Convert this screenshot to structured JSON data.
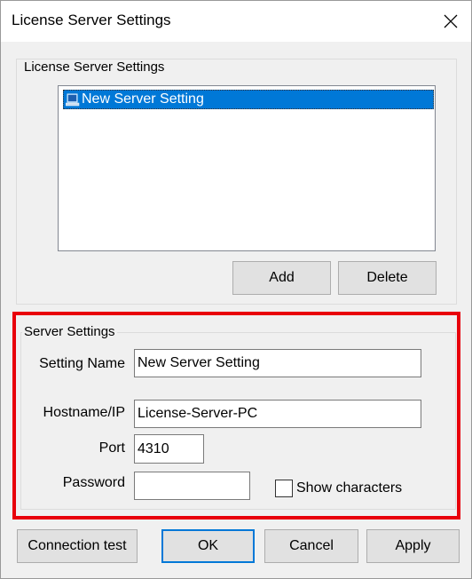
{
  "window": {
    "title": "License Server Settings",
    "close_icon": "close-icon"
  },
  "license_group": {
    "label": "License Server Settings",
    "items": [
      {
        "label": "New Server Setting",
        "icon": "server-icon",
        "selected": true
      }
    ],
    "add_label": "Add",
    "delete_label": "Delete"
  },
  "server_group": {
    "label": "Server Settings",
    "setting_name": {
      "label": "Setting Name",
      "value": "New Server Setting"
    },
    "hostname": {
      "label": "Hostname/IP",
      "value": "License-Server-PC"
    },
    "port": {
      "label": "Port",
      "value": "4310"
    },
    "password": {
      "label": "Password",
      "value": ""
    },
    "show_characters": {
      "label": "Show characters",
      "checked": false
    }
  },
  "footer": {
    "connection_test_label": "Connection test",
    "ok_label": "OK",
    "cancel_label": "Cancel",
    "apply_label": "Apply"
  },
  "colors": {
    "selection": "#0078d7",
    "highlight_frame": "#e8000b",
    "dialog_bg": "#f0f0f0"
  }
}
